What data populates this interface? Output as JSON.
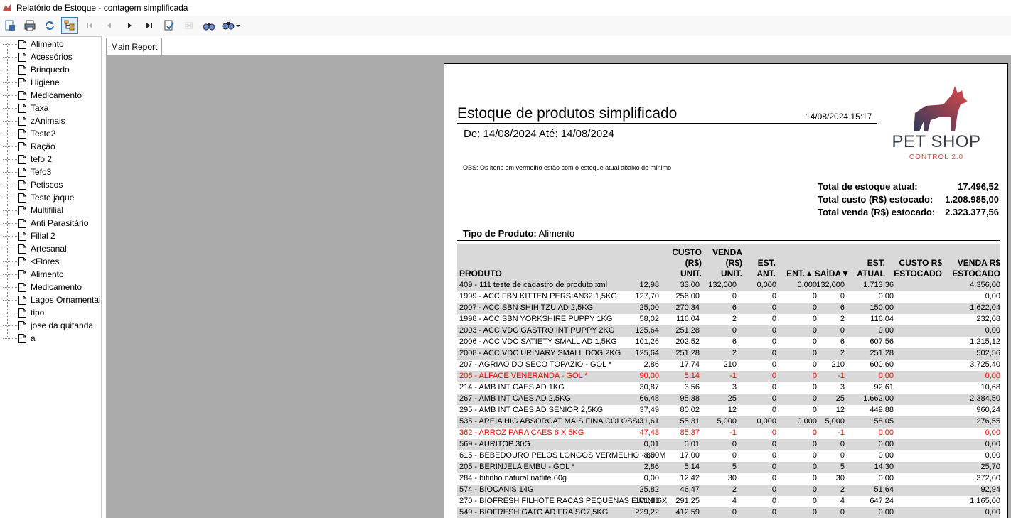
{
  "window": {
    "title": "Relatório de Estoque - contagem simplificada"
  },
  "toolbar": {
    "buttons": [
      "export-icon",
      "print-icon",
      "refresh-icon",
      "tree-toggle-icon",
      "first-page-icon",
      "prev-page-icon",
      "next-page-icon",
      "last-page-icon",
      "goto-page-icon",
      "stop-icon",
      "find-icon",
      "zoom-icon"
    ]
  },
  "tree": {
    "items": [
      "Alimento",
      "Acessórios",
      "Brinquedo",
      "Higiene",
      "Medicamento",
      "Taxa",
      "zAnimais",
      "Teste2",
      "Ração",
      "tefo 2",
      "Tefo3",
      "Petiscos",
      "Teste jaque",
      "Multifilial",
      "Anti Parasitário",
      "Filial 2",
      "Artesanal",
      "<Flores",
      "Alimento",
      "Medicamento",
      "Lagos Ornamentais",
      "tipo",
      "jose da quitanda",
      "a"
    ]
  },
  "tabs": {
    "main": "Main Report"
  },
  "report": {
    "title": "Estoque de produtos simplificado",
    "printed_at": "14/08/2024 15:17",
    "period": "De: 14/08/2024 Até: 14/08/2024",
    "obs": "OBS: Os itens em vermelho estão com o estoque atual abaixo do mínimo",
    "logo": {
      "name": "PET SHOP",
      "sub": "CONTROL 2.0"
    },
    "totals": {
      "estoque_label": "Total de estoque atual:",
      "estoque_value": "17.496,52",
      "custo_label": "Total custo (R$) estocado:",
      "custo_value": "1.208.985,00",
      "venda_label": "Total venda (R$) estocado:",
      "venda_value": "2.323.377,56"
    },
    "tipo_label": "Tipo de Produto:",
    "tipo_value": "Alimento",
    "columns": {
      "produto": "PRODUTO",
      "custo": "CUSTO\n(R$)\nUNIT.",
      "venda": "VENDA\n(R$)\nUNIT.",
      "ant": "EST.\nANT.",
      "ent": "ENT.▲",
      "saida": "SAÍDA▼",
      "atual": "EST.\nATUAL",
      "custo_est": "CUSTO R$\nESTOCADO",
      "venda_est": "VENDA R$\nESTOCADO"
    },
    "rows": [
      {
        "produto": "409 - 111 teste de cadastro de produto xml",
        "custo": "12,98",
        "venda": "33,00",
        "ant": "132,000",
        "ent": "0,000",
        "saida": "0,000",
        "atual": "132,000",
        "custo_est": "1.713,36",
        "venda_est": "4.356,00",
        "red": false
      },
      {
        "produto": "1999 - ACC FBN KITTEN PERSIAN32 1,5KG",
        "custo": "127,70",
        "venda": "256,00",
        "ant": "0",
        "ent": "0",
        "saida": "0",
        "atual": "0",
        "custo_est": "0,00",
        "venda_est": "0,00",
        "red": false
      },
      {
        "produto": "2007 - ACC SBN SHIH TZU AD 2,5KG",
        "custo": "25,00",
        "venda": "270,34",
        "ant": "6",
        "ent": "0",
        "saida": "0",
        "atual": "6",
        "custo_est": "150,00",
        "venda_est": "1.622,04",
        "red": false
      },
      {
        "produto": "1998 - ACC SBN YORKSHIRE PUPPY 1KG",
        "custo": "58,02",
        "venda": "116,04",
        "ant": "2",
        "ent": "0",
        "saida": "0",
        "atual": "2",
        "custo_est": "116,04",
        "venda_est": "232,08",
        "red": false
      },
      {
        "produto": "2003 - ACC VDC GASTRO INT PUPPY 2KG",
        "custo": "125,64",
        "venda": "251,28",
        "ant": "0",
        "ent": "0",
        "saida": "0",
        "atual": "0",
        "custo_est": "0,00",
        "venda_est": "0,00",
        "red": false
      },
      {
        "produto": "2006 - ACC VDC SATIETY SMALL AD 1,5KG",
        "custo": "101,26",
        "venda": "202,52",
        "ant": "6",
        "ent": "0",
        "saida": "0",
        "atual": "6",
        "custo_est": "607,56",
        "venda_est": "1.215,12",
        "red": false
      },
      {
        "produto": "2008 - ACC VDC URINARY SMALL DOG 2KG",
        "custo": "125,64",
        "venda": "251,28",
        "ant": "2",
        "ent": "0",
        "saida": "0",
        "atual": "2",
        "custo_est": "251,28",
        "venda_est": "502,56",
        "red": false
      },
      {
        "produto": "207 - AGRIAO DO SECO TOPAZIO - GOL *",
        "custo": "2,86",
        "venda": "17,74",
        "ant": "210",
        "ent": "0",
        "saida": "0",
        "atual": "210",
        "custo_est": "600,60",
        "venda_est": "3.725,40",
        "red": false
      },
      {
        "produto": "206 - ALFACE VENERANDA - GOL *",
        "custo": "90,00",
        "venda": "5,14",
        "ant": "-1",
        "ent": "0",
        "saida": "0",
        "atual": "-1",
        "custo_est": "0,00",
        "venda_est": "0,00",
        "red": true
      },
      {
        "produto": "214 - AMB INT CAES AD 1KG",
        "custo": "30,87",
        "venda": "3,56",
        "ant": "3",
        "ent": "0",
        "saida": "0",
        "atual": "3",
        "custo_est": "92,61",
        "venda_est": "10,68",
        "red": false
      },
      {
        "produto": "267 - AMB INT CAES AD 2,5KG",
        "custo": "66,48",
        "venda": "95,38",
        "ant": "25",
        "ent": "0",
        "saida": "0",
        "atual": "25",
        "custo_est": "1.662,00",
        "venda_est": "2.384,50",
        "red": false
      },
      {
        "produto": "295 - AMB INT CAES AD SENIOR 2,5KG",
        "custo": "37,49",
        "venda": "80,02",
        "ant": "12",
        "ent": "0",
        "saida": "0",
        "atual": "12",
        "custo_est": "449,88",
        "venda_est": "960,24",
        "red": false
      },
      {
        "produto": "535 - AREIA HIG ABSORCAT MAIS FINA COLOSSO",
        "custo": "31,61",
        "venda": "55,31",
        "ant": "5,000",
        "ent": "0,000",
        "saida": "0,000",
        "atual": "5,000",
        "custo_est": "158,05",
        "venda_est": "276,55",
        "red": false
      },
      {
        "produto": "362 - ARROZ PARA CAES 6 X 5KG",
        "custo": "47,43",
        "venda": "85,37",
        "ant": "-1",
        "ent": "0",
        "saida": "0",
        "atual": "-1",
        "custo_est": "0,00",
        "venda_est": "0,00",
        "red": true
      },
      {
        "produto": "569 - AURITOP 30G",
        "custo": "0,01",
        "venda": "0,01",
        "ant": "0",
        "ent": "0",
        "saida": "0",
        "atual": "0",
        "custo_est": "0,00",
        "venda_est": "0,00",
        "red": false
      },
      {
        "produto": "615 - BEBEDOURO PELOS LONGOS VERMELHO - 800M",
        "custo": "8,50",
        "venda": "17,00",
        "ant": "0",
        "ent": "0",
        "saida": "0",
        "atual": "0",
        "custo_est": "0,00",
        "venda_est": "0,00",
        "red": false
      },
      {
        "produto": "205 - BERINJELA EMBU - GOL *",
        "custo": "2,86",
        "venda": "5,14",
        "ant": "5",
        "ent": "0",
        "saida": "0",
        "atual": "5",
        "custo_est": "14,30",
        "venda_est": "25,70",
        "red": false
      },
      {
        "produto": "284 - bifinho natural natlife 60g",
        "custo": "0,00",
        "venda": "12,42",
        "ant": "30",
        "ent": "0",
        "saida": "0",
        "atual": "30",
        "custo_est": "0,00",
        "venda_est": "372,60",
        "red": false
      },
      {
        "produto": "574 - BIOCANIS 14G",
        "custo": "25,82",
        "venda": "46,47",
        "ant": "2",
        "ent": "0",
        "saida": "0",
        "atual": "2",
        "custo_est": "51,64",
        "venda_est": "92,94",
        "red": false
      },
      {
        "produto": "270 - BIOFRESH FILHOTE RACAS PEQUENAS E MINI 6X",
        "custo": "161,81",
        "venda": "291,25",
        "ant": "4",
        "ent": "0",
        "saida": "0",
        "atual": "4",
        "custo_est": "647,24",
        "venda_est": "1.165,00",
        "red": false
      },
      {
        "produto": "549 - BIOFRESH GATO AD FRA SC7,5KG",
        "custo": "229,22",
        "venda": "412,59",
        "ant": "0",
        "ent": "0",
        "saida": "0",
        "atual": "0",
        "custo_est": "0,00",
        "venda_est": "0,00",
        "red": false
      }
    ]
  }
}
